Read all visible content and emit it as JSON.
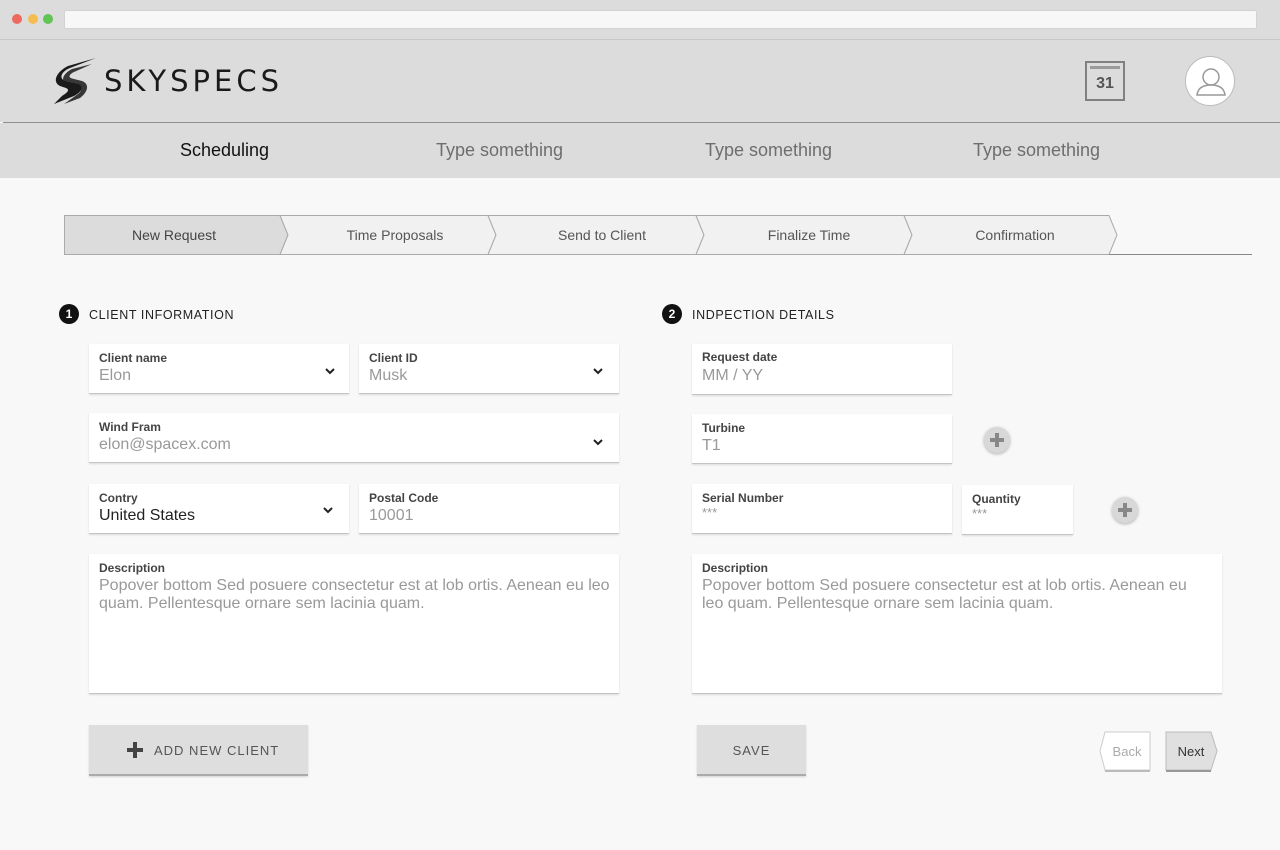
{
  "app": {
    "logo_text": "SKYSPECS"
  },
  "header": {
    "calendar_day": "31"
  },
  "nav": {
    "items": [
      {
        "label": "Scheduling",
        "active": true
      },
      {
        "label": "Type something",
        "active": false
      },
      {
        "label": "Type something",
        "active": false
      },
      {
        "label": "Type something",
        "active": false
      }
    ]
  },
  "stepper": {
    "steps": [
      "New Request",
      "Time Proposals",
      "Send to Client",
      "Finalize Time",
      "Confirmation"
    ],
    "active_index": 0
  },
  "client": {
    "number": "1",
    "title": "CLIENT INFORMATION",
    "name": {
      "label": "Client name",
      "value": "Elon"
    },
    "id": {
      "label": "Client ID",
      "value": "Musk"
    },
    "wind_farm": {
      "label": "Wind Fram",
      "value": "elon@spacex.com"
    },
    "country": {
      "label": "Contry",
      "value": "United States"
    },
    "postal": {
      "label": "Postal Code",
      "value": "10001"
    },
    "description": {
      "label": "Description",
      "value": "Popover bottom Sed posuere consectetur est at lob ortis. Aenean eu leo quam. Pellentesque ornare sem lacinia quam."
    },
    "add_button": "ADD NEW CLIENT"
  },
  "inspection": {
    "number": "2",
    "title": "INDPECTION DETAILS",
    "request_date": {
      "label": "Request date",
      "value": "MM / YY"
    },
    "turbine": {
      "label": "Turbine",
      "value": "T1"
    },
    "serial": {
      "label": "Serial Number",
      "value": "***"
    },
    "quantity": {
      "label": "Quantity",
      "value": "***"
    },
    "description": {
      "label": "Description",
      "value": "Popover bottom Sed posuere consectetur est at lob ortis. Aenean eu leo quam. Pellentesque ornare sem lacinia quam."
    },
    "save_button": "SAVE"
  },
  "pager": {
    "back": "Back",
    "next": "Next"
  },
  "colors": {
    "header_bg": "#dcdcdc",
    "page_bg": "#f8f8f8",
    "active_step_bg": "#dcdcdc"
  }
}
